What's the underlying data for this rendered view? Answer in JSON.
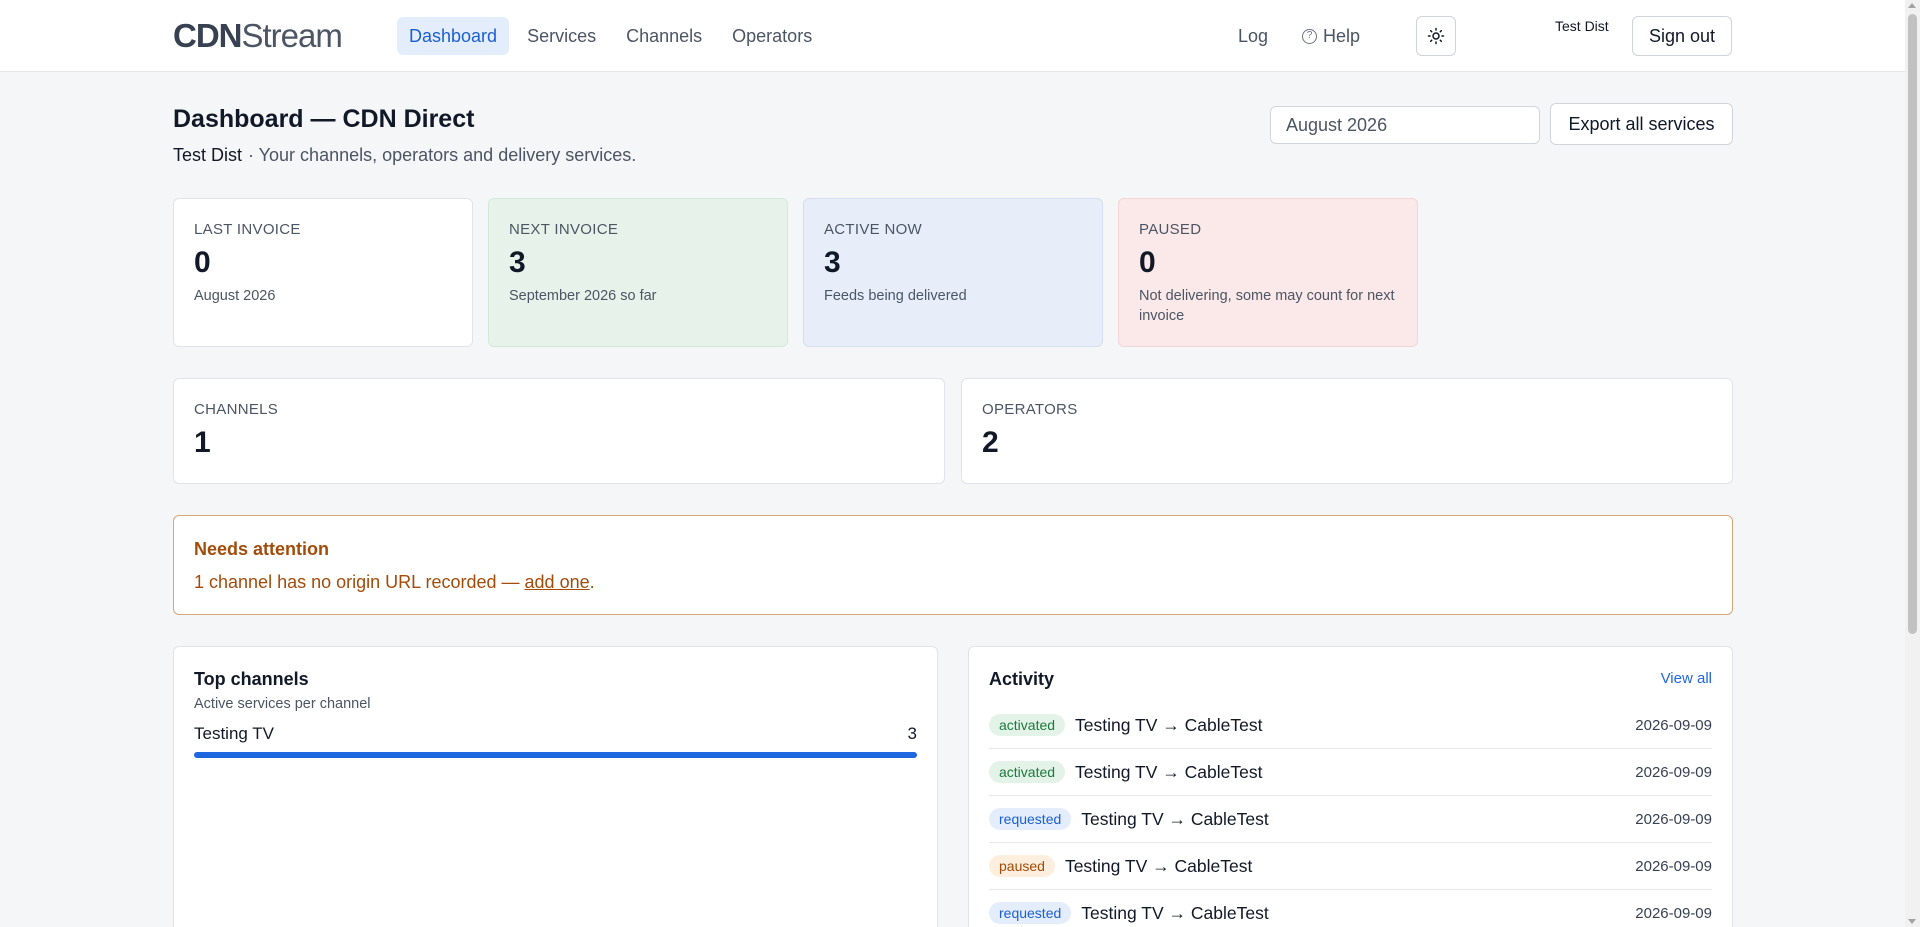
{
  "app": {
    "logo_bold": "CDN",
    "logo_rest": "Stream"
  },
  "nav": {
    "items": [
      {
        "label": "Dashboard",
        "active": true
      },
      {
        "label": "Services"
      },
      {
        "label": "Channels"
      },
      {
        "label": "Operators"
      }
    ],
    "log": "Log",
    "help": "Help",
    "help_icon": "?",
    "theme_icon": "sun-icon",
    "user": "Test Dist",
    "signout": "Sign out"
  },
  "header": {
    "title": "Dashboard — CDN Direct",
    "org": "Test Dist",
    "tagline": "· Your channels, operators and delivery services.",
    "month_value": "August 2026",
    "export_label": "Export all services"
  },
  "stats": [
    {
      "label": "LAST INVOICE",
      "value": "0",
      "sub": "August 2026"
    },
    {
      "label": "NEXT INVOICE",
      "value": "3",
      "sub": "September 2026 so far"
    },
    {
      "label": "ACTIVE NOW",
      "value": "3",
      "sub": "Feeds being delivered"
    },
    {
      "label": "PAUSED",
      "value": "0",
      "sub": "Not delivering, some may count for next invoice"
    }
  ],
  "counts": [
    {
      "label": "CHANNELS",
      "value": "1"
    },
    {
      "label": "OPERATORS",
      "value": "2"
    }
  ],
  "attention": {
    "title": "Needs attention",
    "message": "1 channel has no origin URL recorded — ",
    "link": "add one",
    "suffix": "."
  },
  "top_channels": {
    "title": "Top channels",
    "subtitle": "Active services per channel",
    "rows": [
      {
        "name": "Testing TV",
        "count": "3",
        "fill": 1.0
      }
    ]
  },
  "activity": {
    "title": "Activity",
    "view_all": "View all",
    "rows": [
      {
        "status": "activated",
        "text": "Testing TV → CableTest",
        "date": "2026-09-09"
      },
      {
        "status": "activated",
        "text": "Testing TV → CableTest",
        "date": "2026-09-09"
      },
      {
        "status": "requested",
        "text": "Testing TV → CableTest",
        "date": "2026-09-09"
      },
      {
        "status": "paused",
        "text": "Testing TV → CableTest",
        "date": "2026-09-09"
      },
      {
        "status": "requested",
        "text": "Testing TV → CableTest",
        "date": "2026-09-09"
      }
    ]
  },
  "colors": {
    "accent": "#1f67de",
    "attention": "#a24c0a"
  }
}
